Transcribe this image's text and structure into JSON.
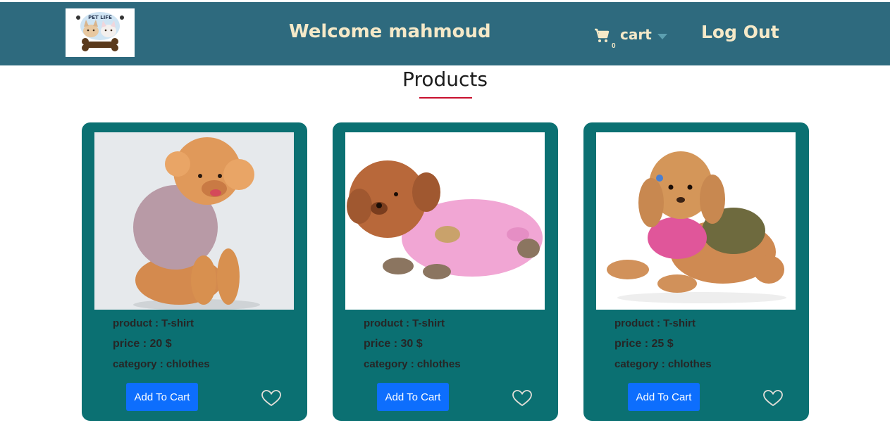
{
  "header": {
    "logo_text": "PET LIFE",
    "welcome": "Welcome mahmoud",
    "cart_label": "cart",
    "cart_count": "0",
    "logout": "Log Out",
    "colors": {
      "bar": "#2e6a7e",
      "text": "#f5e9c8"
    },
    "icons": {
      "cart": "cart-icon",
      "dropdown": "caret-down-icon"
    }
  },
  "main": {
    "title": "Products",
    "accent_color": "#c8102e"
  },
  "products": [
    {
      "product": "product : T-shirt",
      "price": "price : 20  $",
      "category": "category : chlothes",
      "button": "Add To Cart"
    },
    {
      "product": "product : T-shirt",
      "price": "price : 30  $",
      "category": "category : chlothes",
      "button": "Add To Cart"
    },
    {
      "product": "product : T-shirt",
      "price": "price : 25  $",
      "category": "category : chlothes",
      "button": "Add To Cart"
    }
  ],
  "card_style": {
    "background": "#0b7072",
    "button": "#0d6efd",
    "favorite_icon": "heart-outline-icon"
  }
}
